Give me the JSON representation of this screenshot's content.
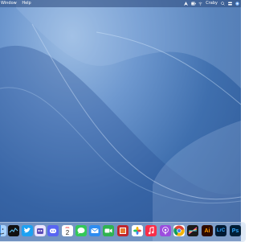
{
  "menubar": {
    "left_items": [
      "Window",
      "Help"
    ],
    "clock_label": "Craby",
    "right_icons": [
      "location-icon",
      "battery-icon",
      "wifi-icon",
      "user-label",
      "search-icon",
      "control-center-icon",
      "siri-icon"
    ]
  },
  "dock": {
    "apps": [
      {
        "name": "finder",
        "label": ""
      },
      {
        "name": "system-monitor",
        "label": ""
      },
      {
        "name": "twitter",
        "label": ""
      },
      {
        "name": "robot-app",
        "label": ""
      },
      {
        "name": "discord",
        "label": ""
      },
      {
        "name": "calendar",
        "label": "2",
        "month": "JUL"
      },
      {
        "name": "messages",
        "label": ""
      },
      {
        "name": "mail",
        "label": ""
      },
      {
        "name": "facetime",
        "label": ""
      },
      {
        "name": "photo-booth",
        "label": ""
      },
      {
        "name": "photos",
        "label": ""
      },
      {
        "name": "music",
        "label": ""
      },
      {
        "name": "podcasts",
        "label": ""
      },
      {
        "name": "chrome",
        "label": ""
      },
      {
        "name": "final-cut",
        "label": ""
      },
      {
        "name": "illustrator",
        "label": "Ai"
      },
      {
        "name": "lightroom",
        "label": "LrC"
      },
      {
        "name": "photoshop",
        "label": "Ps"
      }
    ]
  },
  "colors": {
    "wallpaper_top": "#9fbfe4",
    "wallpaper_bottom": "#2c5694"
  }
}
